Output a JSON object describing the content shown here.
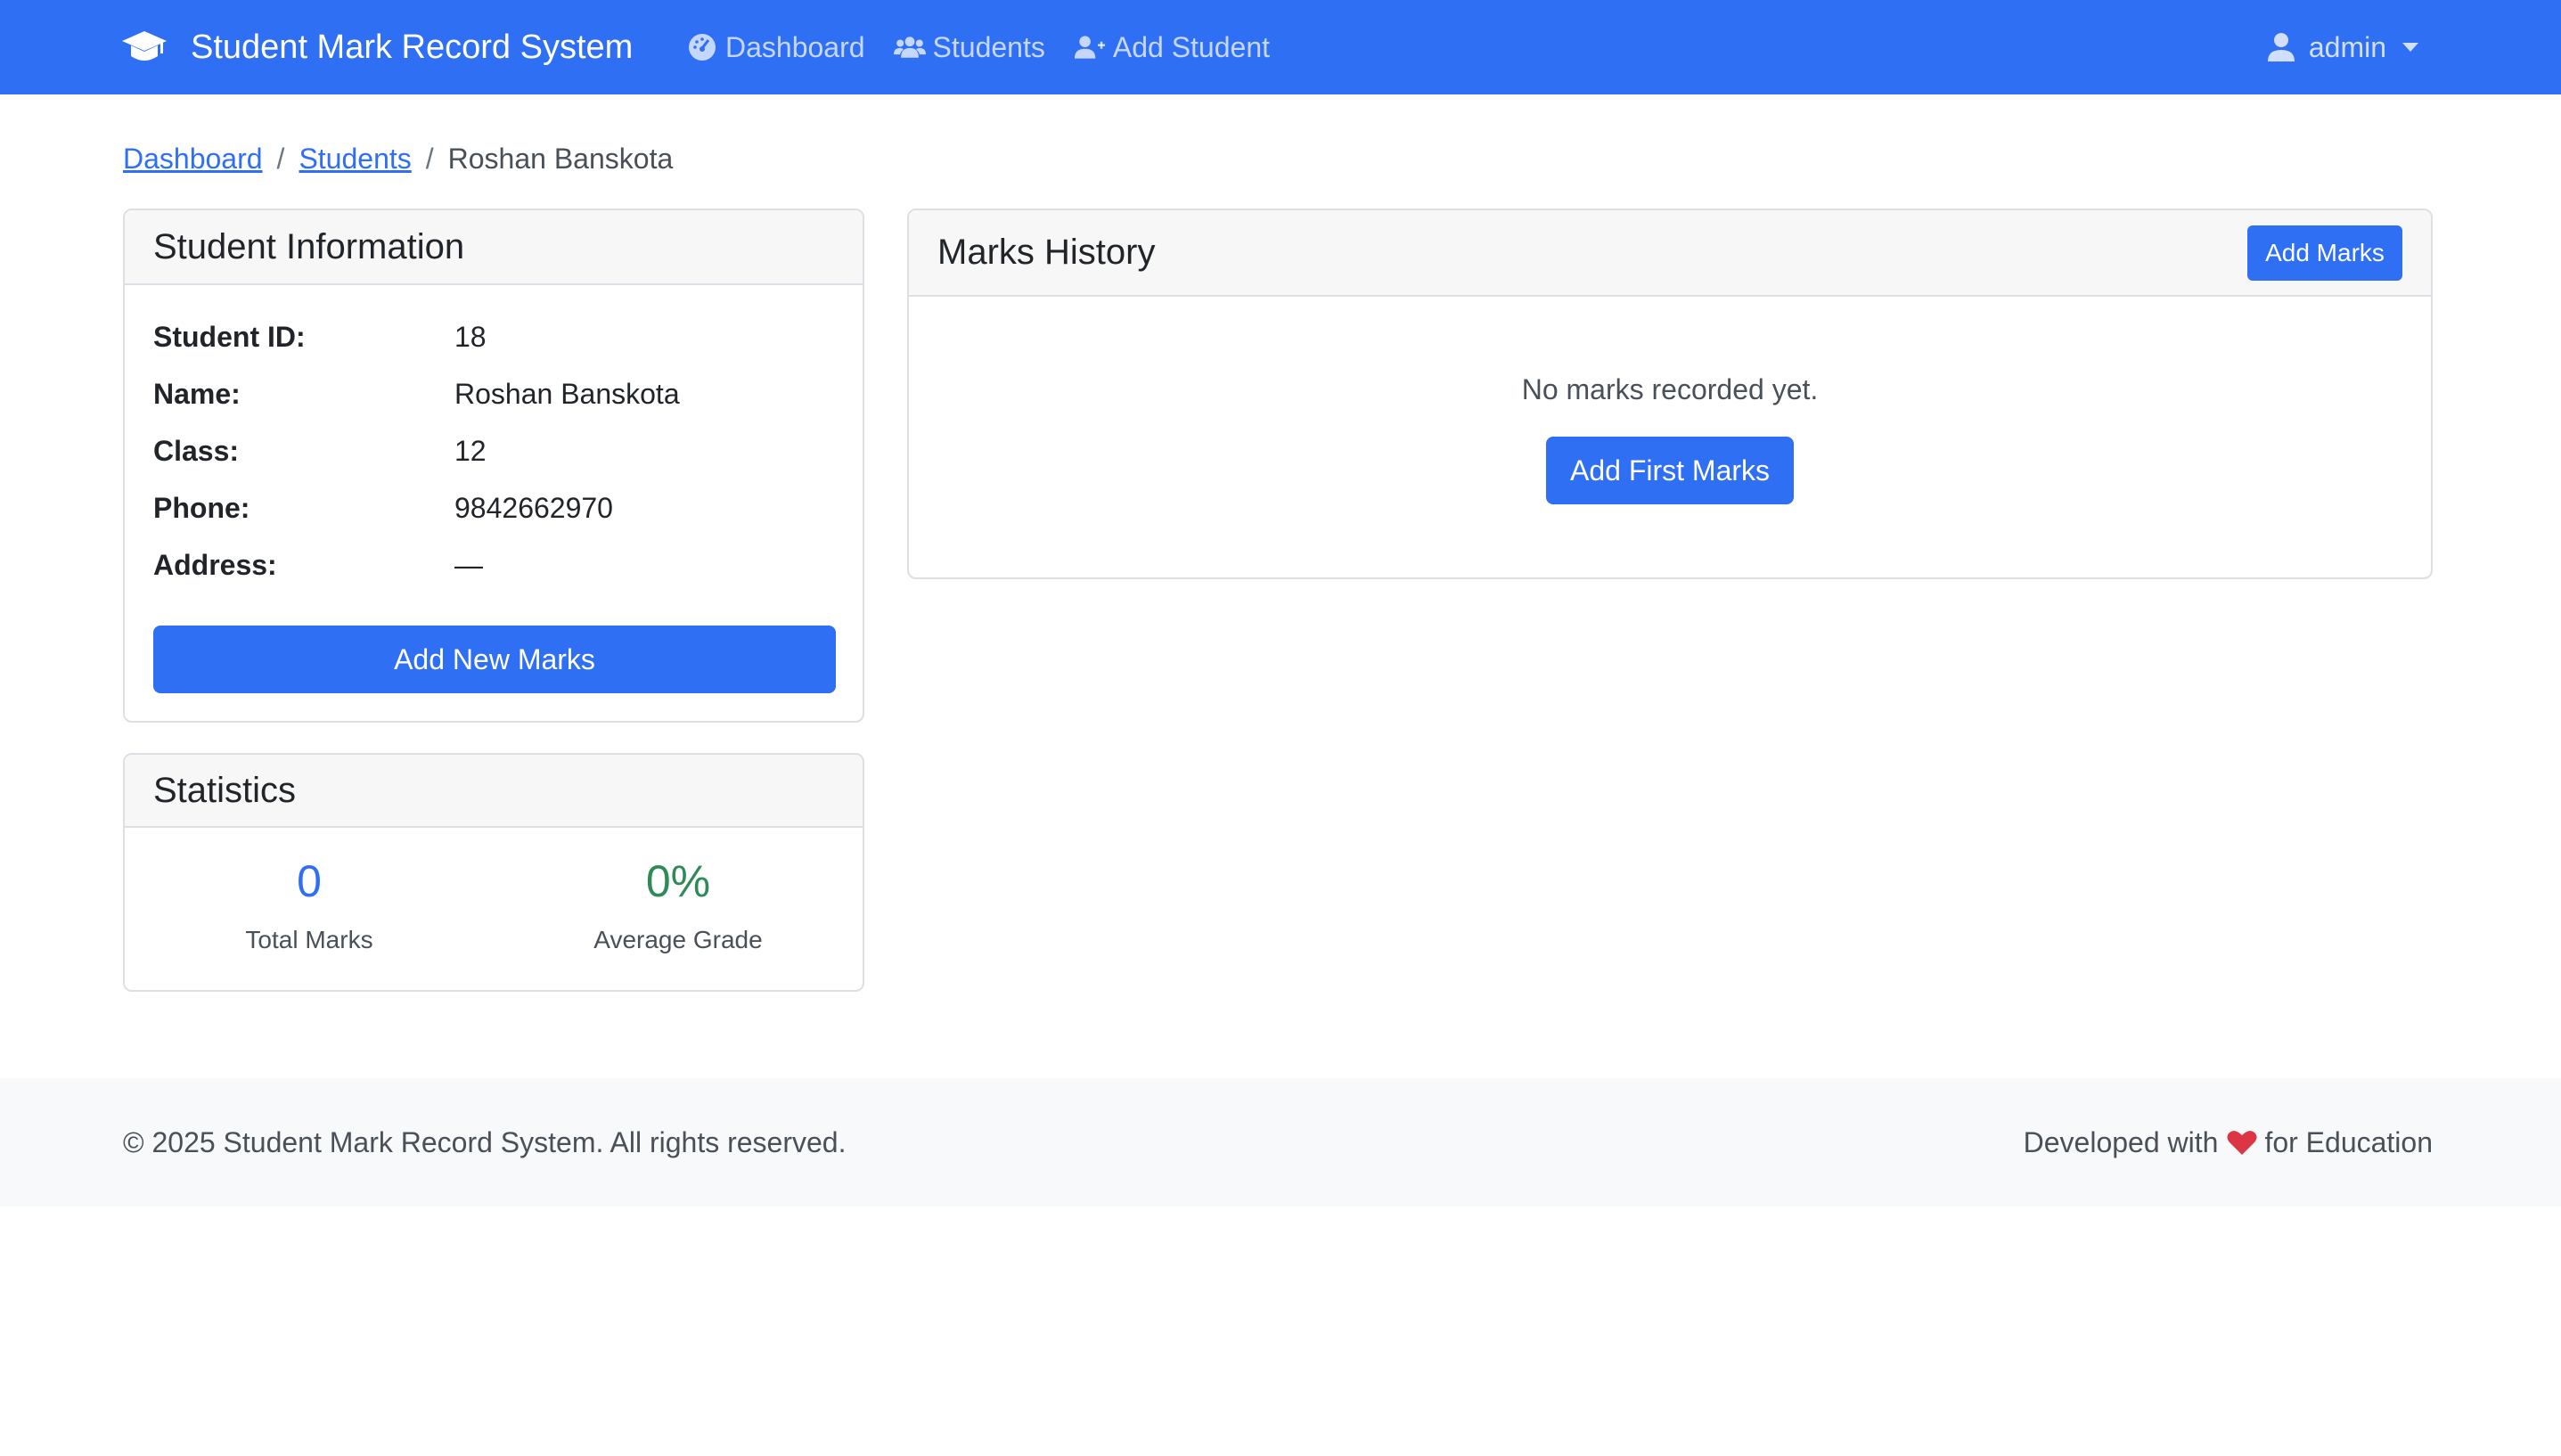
{
  "navbar": {
    "brand": "Student Mark Record System",
    "links": [
      {
        "label": "Dashboard",
        "icon": "dashboard-gauge-icon"
      },
      {
        "label": "Students",
        "icon": "users-icon"
      },
      {
        "label": "Add Student",
        "icon": "user-plus-icon"
      }
    ],
    "user": "admin"
  },
  "breadcrumb": {
    "items": [
      "Dashboard",
      "Students"
    ],
    "separator": "/",
    "active": "Roshan Banskota"
  },
  "student_info": {
    "title": "Student Information",
    "fields": [
      {
        "label": "Student ID:",
        "value": "18"
      },
      {
        "label": "Name:",
        "value": "Roshan Banskota"
      },
      {
        "label": "Class:",
        "value": "12"
      },
      {
        "label": "Phone:",
        "value": "9842662970"
      },
      {
        "label": "Address:",
        "value": "—"
      }
    ],
    "button": "Add New Marks"
  },
  "statistics": {
    "title": "Statistics",
    "total_marks_value": "0",
    "total_marks_label": "Total Marks",
    "average_grade_value": "0%",
    "average_grade_label": "Average Grade"
  },
  "marks_history": {
    "title": "Marks History",
    "add_button": "Add Marks",
    "empty_text": "No marks recorded yet.",
    "first_button": "Add First Marks"
  },
  "footer": {
    "copyright": "© 2025 Student Mark Record System. All rights reserved.",
    "developed_prefix": "Developed with",
    "developed_suffix": "for Education"
  },
  "colors": {
    "primary": "#2f6ff3",
    "success": "#2e8b57",
    "heart": "#dc3545"
  }
}
